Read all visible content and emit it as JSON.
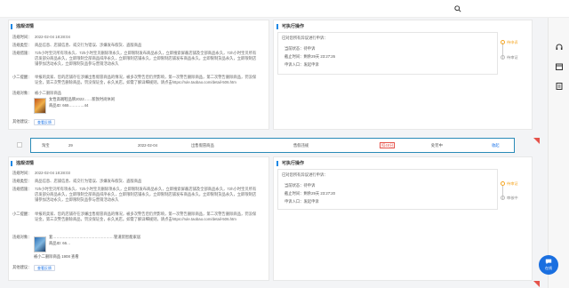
{
  "colors": {
    "accent": "#1a73e8",
    "highlight_border": "#2a8bb8",
    "warn": "#f5a623",
    "danger": "#e5534b"
  },
  "record1": {
    "title": "违规详情",
    "rows": [
      {
        "k": "违规时间：",
        "v": "2022-02-04 18:28:04"
      },
      {
        "k": "违规类型：",
        "v": "商品信息、店铺信息、或交行为错误、涉嫌发布假货、盗版商品"
      },
      {
        "k": "违规措施：",
        "v": "72h小时宝贝所有项永久、72h小时宝贝删除项永久，立即限制发布商品永久，立即搜索屏蔽店铺及全部商品永久，72h小时宝贝所有店发部分商品永久，立即限制全部商品排序永久，立即限制店铺永久，立即限制店铺发布商品永久，立即限制货品永久，立即限制店铺参加活动永久，立即限制货品参与营销活动永久"
      },
      {
        "k": "小二提醒：",
        "v": "举报的卖家、您的店铺存在涉嫌出售假冒商品的情况，被多次警告后仍然影响，第一次警告删除商品，第二次警告删除商品，罚没保证金，第三次警告删除商品，罚没保证金，永久关店。如需了解详细规则，请点击https://rule.taobao.com/detail-506.htm"
      },
      {
        "k": "违规对象：",
        "v": "被小二删除商品"
      }
    ],
    "item_title": "女性高端鞋品牌2022……新款时尚休闲",
    "item_id": "商品ID: 665…………44",
    "suggest_label": "其他建议：",
    "suggest_btn": "查看反馈"
  },
  "ops1": {
    "title": "可执行操作",
    "status_head": "已对您所有异议进行申诉：",
    "lines": [
      "当前状态：待申诉",
      "截止时间：剩余29天 23:27:26",
      "申诉入口：发起申诉"
    ],
    "steps": [
      "待申诉",
      "待审证"
    ]
  },
  "summary": {
    "c1": "淘宝",
    "c2": "29",
    "c3": "2022-02-04",
    "c4": "出售假冒商品",
    "c5": "售假违规",
    "c6": "扣48分",
    "c7": "处罚中",
    "c8": "收起"
  },
  "record2": {
    "title": "违规详情",
    "rows": [
      {
        "k": "违规时间：",
        "v": "2022-02-04 18:28:03"
      },
      {
        "k": "违规类型：",
        "v": "商品信息、店铺信息、或交行为错误、涉嫌发布假货、盗版商品"
      },
      {
        "k": "违规措施：",
        "v": "72h小时宝贝所有项永久、72h小时宝贝删除项永久，立即限制发布商品永久，立即搜索屏蔽店铺及全部商品永久，72h小时宝贝所有店发部分商品永久，立即限制全部商品排序永久，立即限制店铺永久，立即限制店铺发布商品永久，立即限制货品永久，立即限制店铺参加活动永久，立即限制货品参与营销活动永久"
      },
      {
        "k": "小二提醒：",
        "v": "举报的卖家、您的店铺存在涉嫌出售假冒商品的情况，被多次警告后仍然影响，第一次警告删除商品，第二次警告删除商品，罚没保证金，第三次警告删除商品，罚没保证金，永久关店。如需了解详细规则，请点击https://rule.taobao.com/detail-506.htm"
      },
      {
        "k": "违规对象：",
        "v": "被小二删除商品"
      }
    ],
    "item_title": "套…………………………………………管道装智能家居",
    "item_id": "商品ID: 66…",
    "item_extra": "被小二删除商品 1908 查看",
    "suggest_label": "其他建议：",
    "suggest_btn": "查看反馈"
  },
  "ops2": {
    "title": "可执行操作",
    "status_head": "已对您所有异议进行申诉：",
    "lines": [
      "当前状态：待申诉",
      "截止时间：剩余29天 23:27:20",
      "申诉入口：发起申诉"
    ],
    "steps": [
      "待审证",
      "审核中"
    ]
  },
  "help": {
    "label": "在线"
  }
}
